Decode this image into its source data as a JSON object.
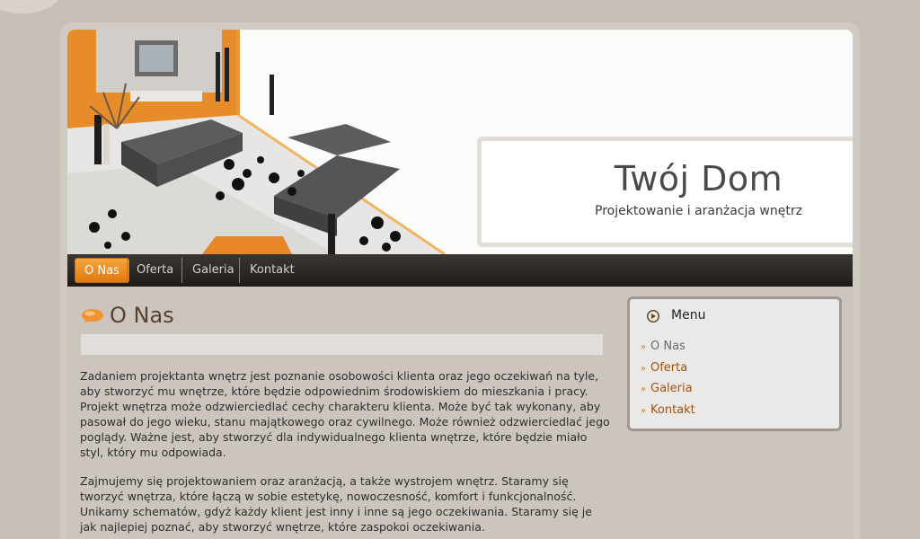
{
  "site": {
    "title": "Twój Dom",
    "subtitle": "Projektowanie i aranżacja wnętrz"
  },
  "nav": {
    "items": [
      {
        "label": "O Nas",
        "active": true
      },
      {
        "label": "Oferta",
        "active": false
      },
      {
        "label": "Galeria",
        "active": false
      },
      {
        "label": "Kontakt",
        "active": false
      }
    ]
  },
  "main": {
    "title": "O Nas",
    "paragraphs": [
      "Zadaniem projektanta wnętrz jest poznanie osobowości klienta oraz jego oczekiwań na tyle, aby stworzyć mu wnętrze, które będzie odpowiednim środowiskiem do mieszkania i pracy. Projekt wnętrza może odzwierciedlać cechy charakteru klienta. Może być tak wykonany, aby pasował do jego wieku, stanu majątkowego oraz cywilnego. Może również odzwierciedlać jego poglądy. Ważne jest, aby stworzyć dla indywidualnego klienta wnętrze, które będzie miało styl, który mu odpowiada.",
      "Zajmujemy się projektowaniem oraz aranżacją, a także wystrojem wnętrz. Staramy się tworzyć wnętrza, które łączą w sobie estetykę, nowoczesność, komfort i funkcjonalność. Unikamy schematów, gdyż każdy klient jest inny i inne są jego oczekiwania. Staramy się je jak najlepiej poznać, aby stworzyć wnętrze, które zaspokoi oczekiwania."
    ]
  },
  "sidebar": {
    "menu_title": "Menu",
    "items": [
      {
        "label": "O Nas",
        "current": true
      },
      {
        "label": "Oferta",
        "current": false
      },
      {
        "label": "Galeria",
        "current": false
      },
      {
        "label": "Kontakt",
        "current": false
      }
    ]
  },
  "icons": {
    "title_bullet": "speech-bubble-icon",
    "menu_head": "arrow-circle-icon",
    "menu_bullet": "double-chevron-icon"
  },
  "colors": {
    "accent": "#e88a1c",
    "link": "#a3500a",
    "nav_bg": "#2a2725",
    "page_bg": "#c8c0b8"
  }
}
